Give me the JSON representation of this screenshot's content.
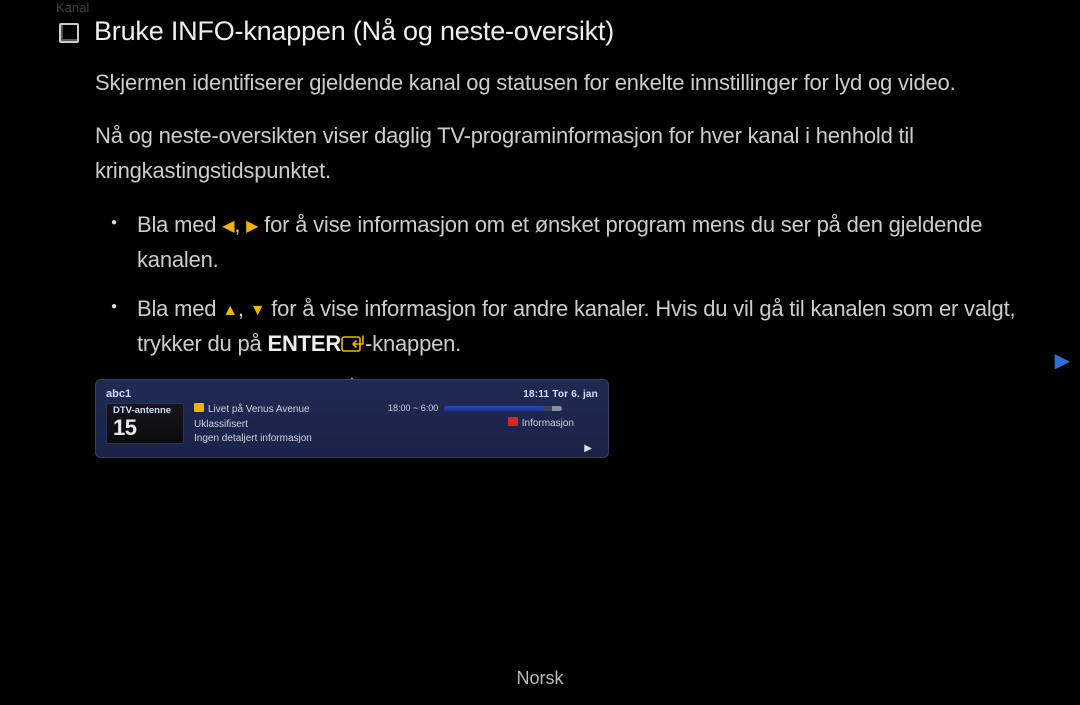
{
  "section_label": "Kanal",
  "title": "Bruke INFO-knappen (Nå og neste-oversikt)",
  "paragraph1": "Skjermen identifiserer gjeldende kanal og statusen for enkelte innstillinger for lyd og video.",
  "paragraph2": "Nå og neste-oversikten viser daglig TV-programinformasjon for hver kanal i henhold til kringkastingstidspunktet.",
  "bullet1": {
    "pre": "Bla med ",
    "mid": ", ",
    "post": " for å vise informasjon om et ønsket program mens du ser på den gjeldende kanalen."
  },
  "bullet2": {
    "pre": "Bla med ",
    "mid": ", ",
    "post1": " for å vise informasjon for andre kanaler. Hvis du vil gå til kanalen som er valgt, trykker du på ",
    "enter_label": "ENTER",
    "post2": "-knappen."
  },
  "panel": {
    "channel_name": "abc1",
    "clock": "18:11 Tor 6. jan",
    "tuner_type": "DTV-antenne",
    "channel_number": "15",
    "program_title": "Livet på Venus Avenue",
    "rating": "Uklassifisert",
    "detail": "Ingen detaljert informasjon",
    "time_range": "18:00 ~ 6:00",
    "info_label": "Informasjon"
  },
  "footer": "Norsk"
}
